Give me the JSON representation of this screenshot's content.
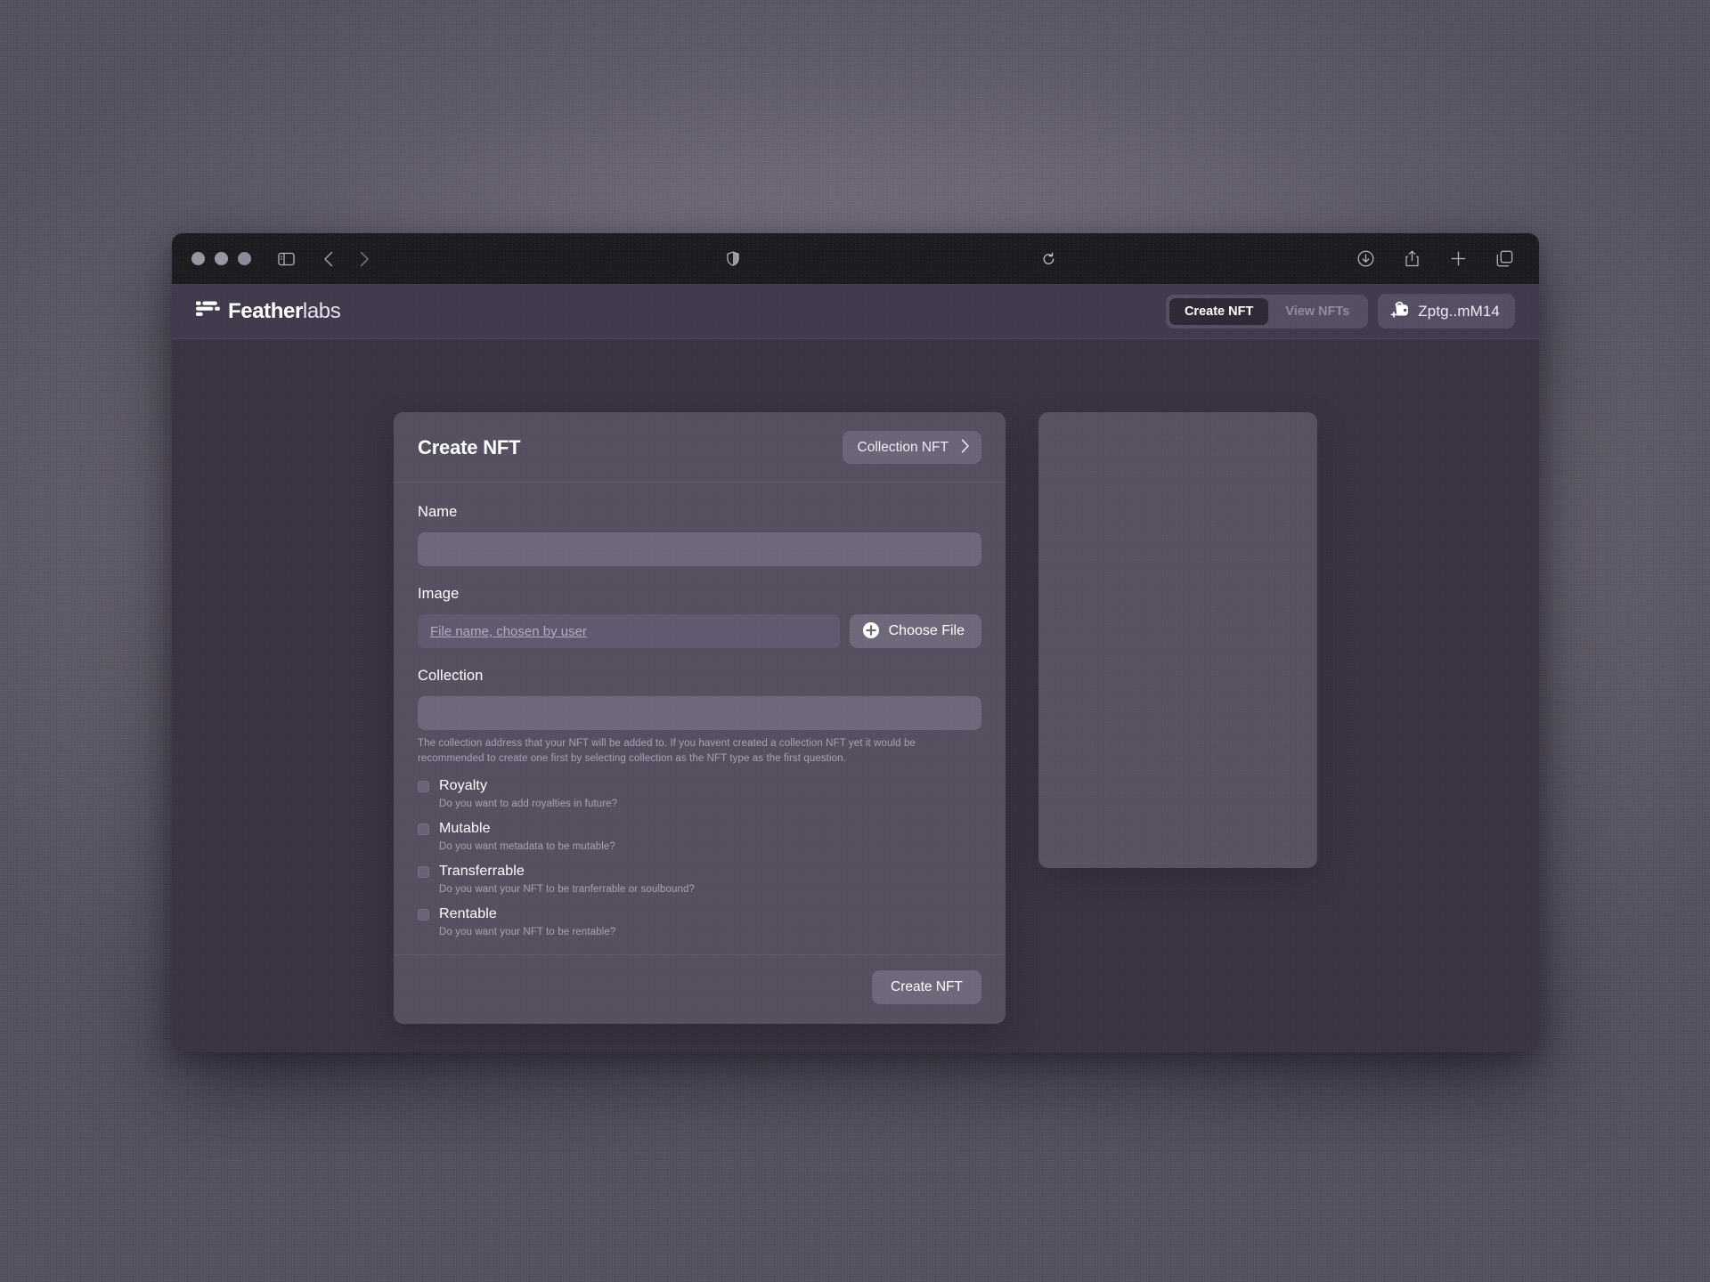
{
  "browser": {
    "traffic_lights": [
      "close",
      "minimize",
      "maximize"
    ],
    "sidebar_icon": "sidebar-icon",
    "back_icon": "chevron-left-icon",
    "forward_icon": "chevron-right-icon",
    "shield_icon": "shield-icon",
    "reload_icon": "reload-icon",
    "url_text": "",
    "download_icon": "download-icon",
    "share_icon": "share-icon",
    "new_tab_icon": "plus-icon",
    "tabs_icon": "tabs-icon"
  },
  "site_header": {
    "brand_bold": "Feather",
    "brand_light": "labs",
    "nav": [
      {
        "label": "Create NFT",
        "active": true
      },
      {
        "label": "View NFTs",
        "active": false
      }
    ],
    "wallet": {
      "label": "Zptg..mM14",
      "icon": "wallet-add-icon"
    }
  },
  "create_card": {
    "title": "Create NFT",
    "nft_type": {
      "label": "Collection NFT",
      "chevron": "chevron-right-icon"
    },
    "fields": {
      "name": {
        "label": "Name",
        "value": "",
        "placeholder": ""
      },
      "image": {
        "label": "Image",
        "file_name_value": "",
        "file_name_placeholder": "File name, chosen by user",
        "choose_file_label": "Choose File",
        "choose_file_icon": "plus-circle-icon"
      },
      "collection": {
        "label": "Collection",
        "value": "",
        "placeholder": "",
        "help": "The collection address that your NFT will be added to. If you havent created a collection NFT yet it would be recommended to create one first by selecting collection as the NFT type as the first question."
      }
    },
    "options": [
      {
        "label": "Royalty",
        "help": "Do you want to add royalties in future?",
        "checked": false
      },
      {
        "label": "Mutable",
        "help": "Do you want metadata to be mutable?",
        "checked": false
      },
      {
        "label": "Transferrable",
        "help": "Do you want your NFT to be tranferrable or soulbound?",
        "checked": false
      },
      {
        "label": "Rentable",
        "help": "Do you want your NFT to be rentable?",
        "checked": false
      }
    ],
    "submit_label": "Create NFT"
  },
  "preview_panel": {
    "content": ""
  },
  "colors": {
    "page_background": "#3a3344",
    "header_background": "#413a4c",
    "card_background": "#564f60",
    "input_background": "#6f687b",
    "accent_dark": "#2f2937",
    "text_primary": "#ffffff",
    "text_muted": "#aaa2b5",
    "browser_chrome": "#1b1b20"
  }
}
